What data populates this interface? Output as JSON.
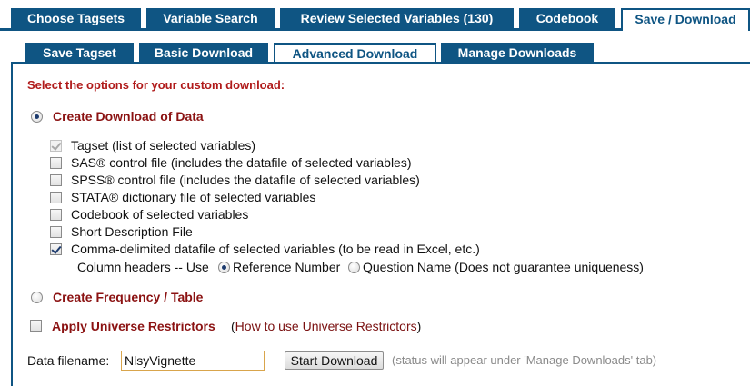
{
  "top_tabs": [
    {
      "label": "Choose Tagsets"
    },
    {
      "label": "Variable Search"
    },
    {
      "label": "Review Selected Variables (130)"
    },
    {
      "label": "Codebook"
    },
    {
      "label": "Save / Download",
      "active": true
    }
  ],
  "sub_tabs": [
    {
      "label": "Save Tagset"
    },
    {
      "label": "Basic Download"
    },
    {
      "label": "Advanced Download",
      "active": true
    },
    {
      "label": "Manage Downloads"
    }
  ],
  "panel": {
    "heading": "Select the options for your custom download:",
    "create_data": {
      "label": "Create Download of Data",
      "selected": true
    },
    "options": [
      {
        "label": "Tagset (list of selected variables)",
        "checked": true,
        "disabled": true
      },
      {
        "label": "SAS® control file (includes the datafile of selected variables)",
        "checked": false
      },
      {
        "label": "SPSS® control file (includes the datafile of selected variables)",
        "checked": false
      },
      {
        "label": "STATA® dictionary file of selected variables",
        "checked": false
      },
      {
        "label": "Codebook of selected variables",
        "checked": false
      },
      {
        "label": "Short Description File",
        "checked": false
      },
      {
        "label": "Comma-delimited datafile of selected variables (to be read in Excel, etc.)",
        "checked": true
      }
    ],
    "column_headers": {
      "prefix": "Column headers -- Use",
      "option_ref": "Reference Number",
      "option_question": "Question Name (Does not guarantee uniqueness)",
      "selected": "ref"
    },
    "create_frequency": {
      "label": "Create Frequency / Table",
      "selected": false
    },
    "universe": {
      "label": "Apply Universe Restrictors",
      "checked": false,
      "link_open": "(",
      "link": "How to use Universe Restrictors",
      "link_close": ")"
    },
    "filename": {
      "label": "Data filename:",
      "value": "NlsyVignette",
      "button": "Start Download",
      "status": "(status will appear under 'Manage Downloads' tab)"
    }
  },
  "colors": {
    "tab_blue": "#0f5583",
    "heading_red": "#b01a1a",
    "section_red": "#8b1212"
  }
}
